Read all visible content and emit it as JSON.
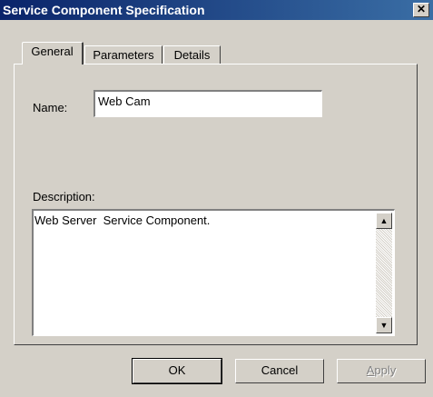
{
  "window": {
    "title": "Service Component Specification",
    "close_glyph": "✕"
  },
  "tabs": [
    {
      "label": "General",
      "selected": true
    },
    {
      "label": "Parameters",
      "selected": false
    },
    {
      "label": "Details",
      "selected": false
    }
  ],
  "general": {
    "name_label": "Name:",
    "name_value": "Web Cam",
    "description_label": "Description:",
    "description_value": "Web Server  Service Component."
  },
  "scrollbar": {
    "up_glyph": "▲",
    "down_glyph": "▼"
  },
  "buttons": {
    "ok": "OK",
    "cancel": "Cancel",
    "apply_accel": "A",
    "apply_rest": "pply",
    "apply_enabled": false
  },
  "colors": {
    "titlebar_start": "#0a246a",
    "titlebar_end": "#3a6ea5",
    "dialog_face": "#d4d0c8"
  }
}
